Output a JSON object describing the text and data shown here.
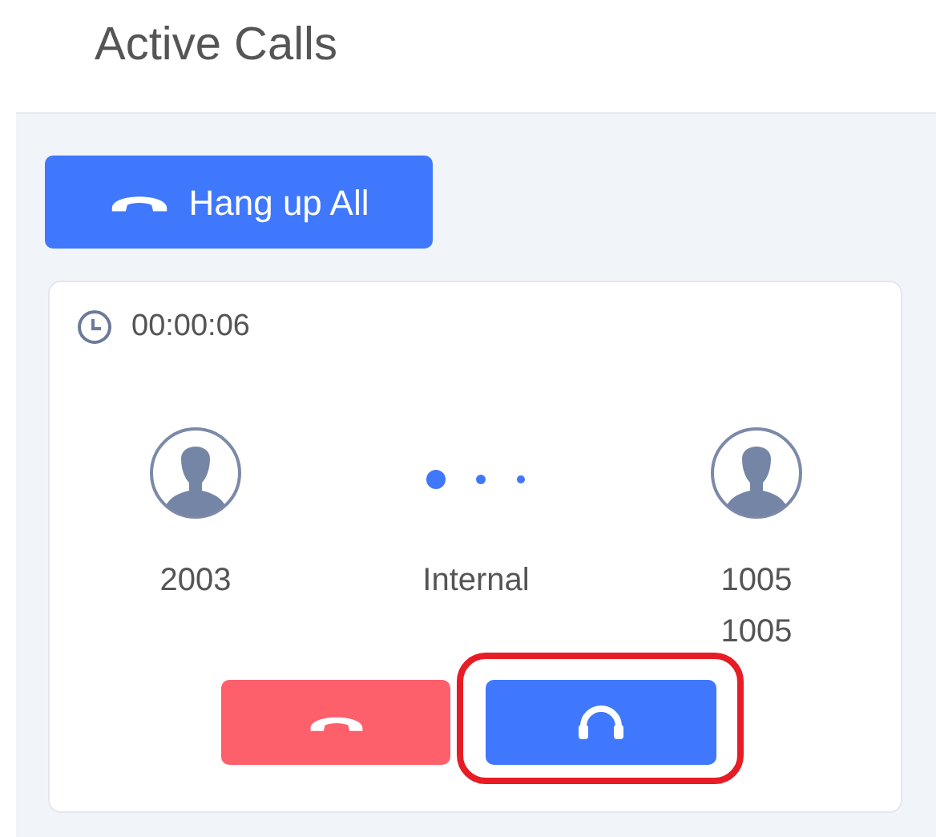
{
  "title": "Active Calls",
  "hangup_all": {
    "label": "Hang up All"
  },
  "call": {
    "duration": "00:00:06",
    "caller": {
      "lines": [
        "2003"
      ]
    },
    "type": "Internal",
    "callee": {
      "lines": [
        "1005",
        "1005"
      ]
    },
    "actions": [
      {
        "kind": "hangup",
        "highlighted": false
      },
      {
        "kind": "listen",
        "highlighted": true
      }
    ]
  }
}
